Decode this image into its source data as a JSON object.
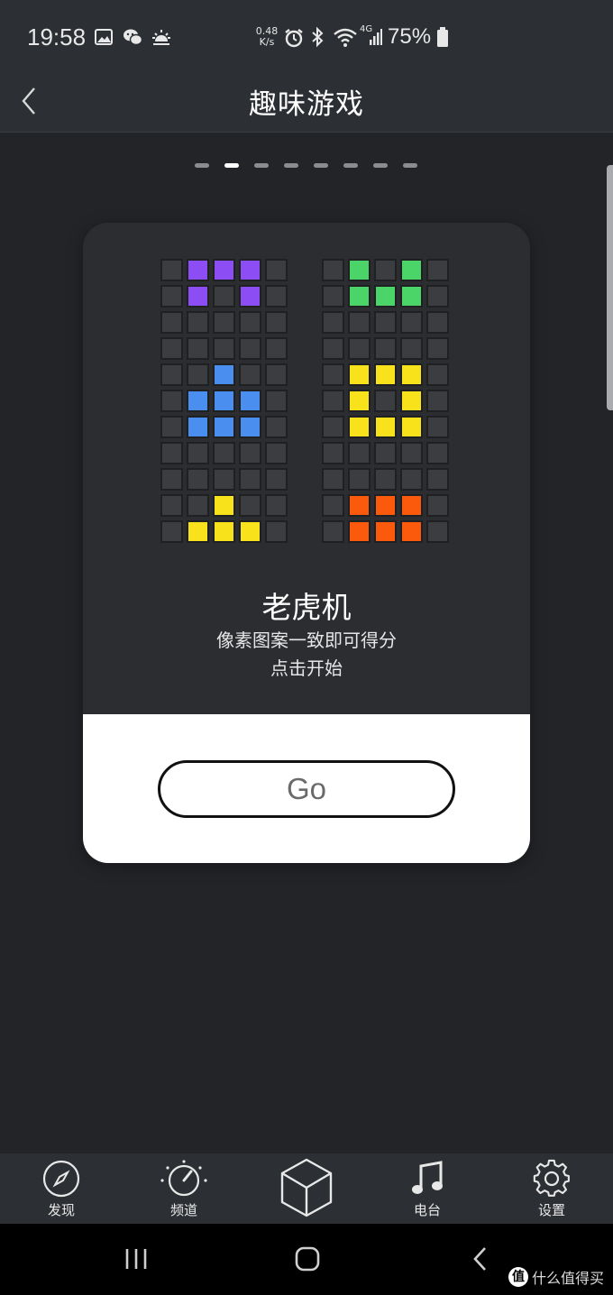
{
  "status_bar": {
    "time": "19:58",
    "net_speed_value": "0.48",
    "net_speed_unit": "K/s",
    "network_type": "4G",
    "battery": "75%",
    "icons_left": [
      "gallery-icon",
      "wechat-icon",
      "weather-icon"
    ],
    "icons_right": [
      "alarm-icon",
      "bluetooth-icon",
      "wifi-icon",
      "signal-icon",
      "battery-icon"
    ]
  },
  "header": {
    "title": "趣味游戏",
    "back_icon": "chevron-left-icon"
  },
  "pager": {
    "count": 8,
    "active_index": 1
  },
  "game_card": {
    "title": "老虎机",
    "description": "像素图案一致即可得分",
    "start_hint": "点击开始",
    "go_button": "Go",
    "colors": {
      "P": "#8c4df5",
      "B": "#4a8ff0",
      "Y": "#f7e21c",
      "G": "#4bd467",
      "O": "#fb5a0d",
      "empty": "#3c3d41"
    },
    "left_grid": [
      ".PPP.",
      ".P.P.",
      ".....",
      ".....",
      "..B..",
      ".BBB.",
      ".BBB.",
      ".....",
      ".....",
      "..Y..",
      ".YYY."
    ],
    "right_grid": [
      ".G.G.",
      ".GGG.",
      ".....",
      ".....",
      ".YYY.",
      ".Y.Y.",
      ".YYY.",
      ".....",
      ".....",
      ".OOO.",
      ".OOO."
    ]
  },
  "tabbar": {
    "items": [
      {
        "label": "发现",
        "icon": "compass-icon"
      },
      {
        "label": "频道",
        "icon": "dial-icon"
      },
      {
        "label": "",
        "icon": "cube-icon"
      },
      {
        "label": "电台",
        "icon": "music-note-icon"
      },
      {
        "label": "设置",
        "icon": "gear-icon"
      }
    ]
  },
  "navbar": {
    "buttons": [
      "recents-icon",
      "home-icon",
      "back-icon"
    ],
    "watermark": "什么值得买",
    "watermark_badge": "值"
  }
}
